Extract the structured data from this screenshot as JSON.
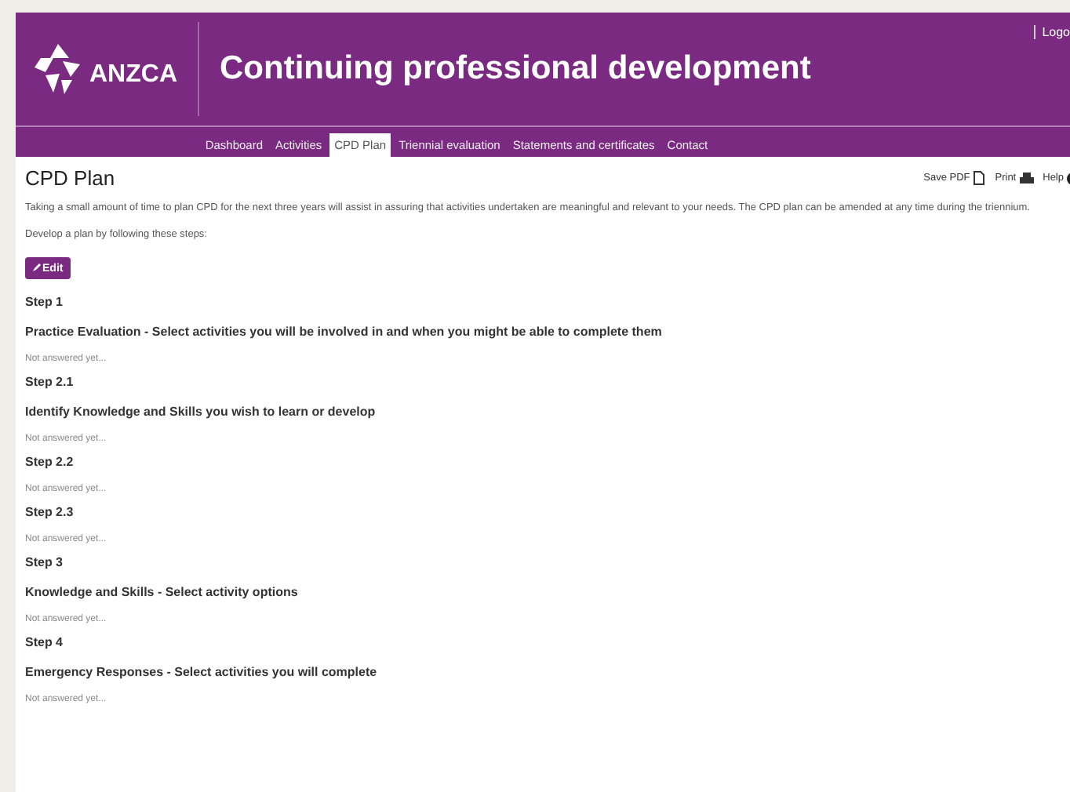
{
  "header": {
    "logo_text": "ANZCA",
    "title": "Continuing professional development",
    "top_link": "Logo"
  },
  "nav": [
    {
      "label": "Dashboard",
      "selected": false
    },
    {
      "label": "Activities",
      "selected": false
    },
    {
      "label": "CPD Plan",
      "selected": true
    },
    {
      "label": "Triennial evaluation",
      "selected": false
    },
    {
      "label": "Statements and certificates",
      "selected": false
    },
    {
      "label": "Contact",
      "selected": false
    }
  ],
  "page": {
    "title": "CPD Plan",
    "actions": [
      {
        "label": "Save PDF",
        "kind": "pdf"
      },
      {
        "label": "Print",
        "kind": "print"
      },
      {
        "label": "Help",
        "kind": "help"
      }
    ],
    "intro": "Taking a small amount of time to plan CPD for the next three years will assist in assuring that activities undertaken are meaningful and relevant to your needs. The CPD plan can be amended at any time during the triennium.",
    "instruction": "Develop a plan by following these steps:",
    "edit_button": "Edit"
  },
  "steps": [
    {
      "label": "Step 1",
      "question": "Practice Evaluation - Select activities you will be involved in and when you might be able to complete them",
      "answer": "Not answered yet..."
    },
    {
      "label": "Step 2.1",
      "question": "Identify Knowledge and Skills you wish to learn or develop",
      "answer": "Not answered yet..."
    },
    {
      "label": "Step 2.2",
      "answer": "Not answered yet..."
    },
    {
      "label": "Step 2.3",
      "answer": "Not answered yet..."
    },
    {
      "label": "Step 3",
      "question": "Knowledge and Skills - Select activity options",
      "answer": "Not answered yet..."
    },
    {
      "label": "Step 4",
      "question": "Emergency Responses - Select activities you will complete",
      "answer": "Not answered yet..."
    }
  ]
}
